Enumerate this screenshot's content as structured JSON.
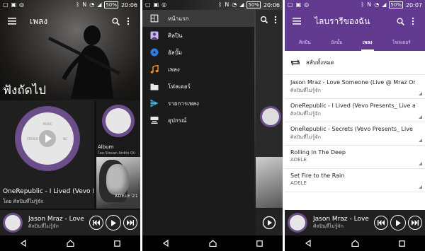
{
  "status_left": {
    "time": "20:06",
    "battery": "50%"
  },
  "status_mid": {
    "time": "20:06",
    "battery": "50%"
  },
  "status_right": {
    "time": "20:07",
    "battery": "50%"
  },
  "screen1": {
    "title": "เพลง",
    "section": "ฟังถัดไป",
    "big_card": {
      "title": "OneRepublic - I Lived (Vevo Pr",
      "subtitle": "โดย ศิลปินที่ไม่รู้จัก",
      "disc_top": "MUSIC",
      "disc_left": "STEREO",
      "disc_right": "NC"
    },
    "album_card": {
      "title": "Album",
      "subtitle": "โดย Stevan Ardito Oli"
    },
    "adele_text": "ADELE 21"
  },
  "mini_player": {
    "title": "Jason Mraz - Love",
    "subtitle": "ศิลปินที่ไม่รู้จัก"
  },
  "drawer": {
    "items": [
      {
        "label": "หน้าแรก",
        "icon": "home-icon",
        "color": "#c8c8c8"
      },
      {
        "label": "ศิลปิน",
        "icon": "artist-icon",
        "color": "#c9b8e8"
      },
      {
        "label": "อัลบั้ม",
        "icon": "album-icon",
        "color": "#2f7de0"
      },
      {
        "label": "เพลง",
        "icon": "music-note-icon",
        "color": "#f28c1e"
      },
      {
        "label": "โฟลเดอร์",
        "icon": "folder-icon",
        "color": "#e8e8e8"
      },
      {
        "label": "รายการเพลง",
        "icon": "playlist-icon",
        "color": "#38b6e0"
      },
      {
        "label": "อุปกรณ์",
        "icon": "devices-icon",
        "color": "#e8e8e8"
      }
    ]
  },
  "library": {
    "title": "ไลบรารีของฉัน",
    "tabs": [
      "ศิลปิน",
      "อัลบั้ม",
      "เพลง",
      "โฟลเดอร์"
    ],
    "active_tab": "เพลง",
    "shuffle_label": "สลับทั้งหมด",
    "songs": [
      {
        "title": "Jason Mraz - Love Someone (Live @ Mraz Org",
        "artist": "ศิลปินที่ไม่รู้จัก"
      },
      {
        "title": "OneRepublic - I Lived (Vevo Presents_ Live at R",
        "artist": "ศิลปินที่ไม่รู้จัก"
      },
      {
        "title": "OneRepublic - Secrets (Vevo Presents_ Live at R",
        "artist": "ศิลปินที่ไม่รู้จัก"
      },
      {
        "title": "Rolling In The Deep",
        "artist": "ADELE"
      },
      {
        "title": "Set Fire to the Rain",
        "artist": "ADELE"
      }
    ]
  },
  "colors": {
    "accent_purple": "#623a90",
    "disc_purple": "#6b4d8a",
    "drawer_bg": "#1b1b1b",
    "mini_player_bg": "#222222"
  }
}
